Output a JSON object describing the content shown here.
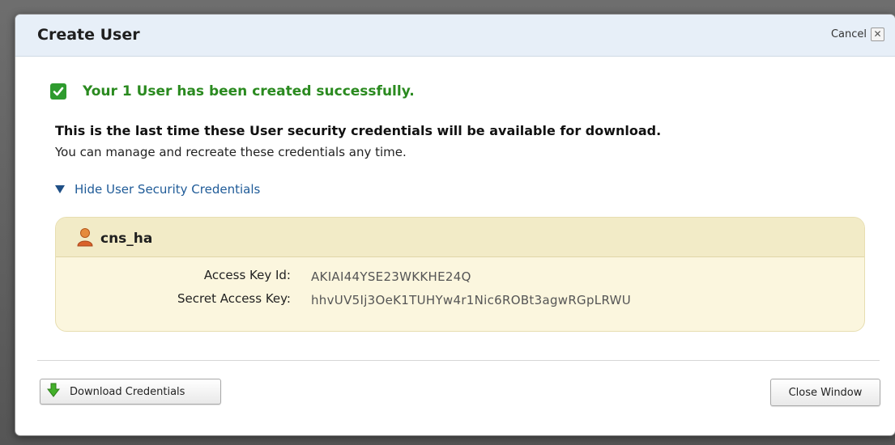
{
  "dialog": {
    "title": "Create User",
    "cancel_label": "Cancel",
    "close_x": "✕"
  },
  "success": {
    "message": "Your 1 User has been created successfully."
  },
  "warning": {
    "strong": "This is the last time these User security credentials will be available for download.",
    "normal": "You can manage and recreate these credentials any time."
  },
  "credentials_toggle": {
    "label": "Hide User Security Credentials"
  },
  "credentials": {
    "user_name": "cns_ha",
    "access_key_label": "Access Key Id:",
    "access_key_value": "AKIAI44YSE23WKKHE24Q",
    "secret_key_label": "Secret Access Key:",
    "secret_key_value": "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"
  },
  "footer": {
    "download_label": "Download Credentials",
    "close_label": "Close Window"
  },
  "colors": {
    "success_green": "#2a8a1f",
    "link_blue": "#1f5b98",
    "panel_bg": "#fbf6de",
    "header_bg": "#e7eff8"
  },
  "icons": {
    "success": "check-icon",
    "toggle": "triangle-down-icon",
    "user": "user-icon",
    "download": "arrow-down-icon",
    "cancel": "close-icon"
  }
}
